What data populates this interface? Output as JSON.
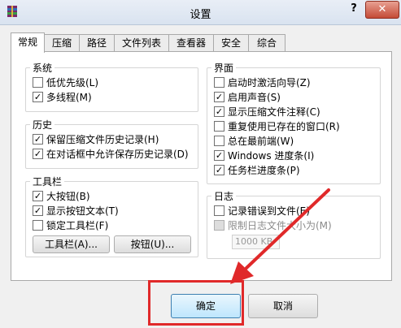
{
  "window": {
    "title": "设置",
    "help_label": "?",
    "close_label": "✕"
  },
  "tabs": [
    "常规",
    "压缩",
    "路径",
    "文件列表",
    "查看器",
    "安全",
    "综合"
  ],
  "groups": {
    "system": {
      "title": "系统",
      "options": [
        {
          "label": "低优先级(L)",
          "checked": false
        },
        {
          "label": "多线程(M)",
          "checked": true
        }
      ]
    },
    "history": {
      "title": "历史",
      "options": [
        {
          "label": "保留压缩文件历史记录(H)",
          "checked": true
        },
        {
          "label": "在对话框中允许保存历史记录(D)",
          "checked": true
        }
      ]
    },
    "toolbar": {
      "title": "工具栏",
      "options": [
        {
          "label": "大按钮(B)",
          "checked": true
        },
        {
          "label": "显示按钮文本(T)",
          "checked": true
        },
        {
          "label": "锁定工具栏(F)",
          "checked": false
        }
      ],
      "buttons": [
        "工具栏(A)...",
        "按钮(U)..."
      ]
    },
    "interface": {
      "title": "界面",
      "options": [
        {
          "label": "启动时激活向导(Z)",
          "checked": false
        },
        {
          "label": "启用声音(S)",
          "checked": true
        },
        {
          "label": "显示压缩文件注释(C)",
          "checked": true
        },
        {
          "label": "重复使用已存在的窗口(R)",
          "checked": false
        },
        {
          "label": "总在最前端(W)",
          "checked": false
        },
        {
          "label": "Windows 进度条(I)",
          "checked": true
        },
        {
          "label": "任务栏进度条(P)",
          "checked": true
        }
      ]
    },
    "log": {
      "title": "日志",
      "options": [
        {
          "label": "记录错误到文件(E)",
          "checked": false
        },
        {
          "label": "限制日志文件大小为(M)",
          "checked": false,
          "disabled": true
        }
      ],
      "size_value": "1000 KB"
    }
  },
  "footer": {
    "ok_label": "确定",
    "cancel_label": "取消"
  },
  "colors": {
    "accent": "#e0292a",
    "ok_border": "#3c7fb1",
    "close": "#c44b37"
  },
  "icons": [
    "winrar-icon",
    "help-icon",
    "close-icon",
    "checkmark-icon",
    "red-arrow"
  ]
}
